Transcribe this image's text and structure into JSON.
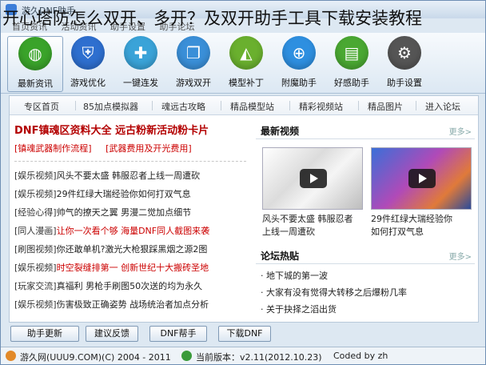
{
  "headline": "开心塔防怎么双开、多开？及双开助手工具下载安装教程",
  "window": {
    "title": "游久DNF助手"
  },
  "menu": [
    "首页资讯",
    "活动资讯",
    "助手设置",
    "助手论坛"
  ],
  "toolbar": [
    {
      "label": "最新资讯",
      "icon": "globe-icon",
      "color": "#3aa32a"
    },
    {
      "label": "游戏优化",
      "icon": "shield-icon",
      "color": "#2e6fcf"
    },
    {
      "label": "一键连发",
      "icon": "gamepad-icon",
      "color": "#3aa3d8"
    },
    {
      "label": "游戏双开",
      "icon": "windows-icon",
      "color": "#3a8fd8"
    },
    {
      "label": "模型补丁",
      "icon": "triangle-icon",
      "color": "#6ab02e"
    },
    {
      "label": "附魔助手",
      "icon": "globe-net-icon",
      "color": "#2e8fe0"
    },
    {
      "label": "好感助手",
      "icon": "document-icon",
      "color": "#4aa832"
    },
    {
      "label": "助手设置",
      "icon": "gear-icon",
      "color": "#555555"
    }
  ],
  "tabs": [
    "专区首页",
    "85加点模拟器",
    "魂远古攻略",
    "精品模型站",
    "精彩视频站",
    "精品图片",
    "进入论坛"
  ],
  "feature": {
    "title": "DNF镇魂区资料大全  远古粉新活动粉卡片",
    "sub1": "[镇魂武器制作流程]",
    "sub2": "[武器费用及开光费用]"
  },
  "news": [
    {
      "tag": "[娱乐视频]",
      "text": "风头不要太盛  韩服忍者上线一周遭砍",
      "red": false
    },
    {
      "tag": "[娱乐视频]",
      "text": "29件红绿大瑞经验你如何打双气息",
      "red": false
    },
    {
      "tag": "[经验心得]",
      "text": "帅气的撩天之翼  男漫二觉加点细节",
      "red": false
    },
    {
      "tag": "[同人漫画]",
      "text": "让你一次看个够  海量DNF同人截图来袭",
      "red": true
    },
    {
      "tag": "[刷图视频]",
      "text": "你还敢单机?激光大枪狠踩黑烟之源2图",
      "red": false
    },
    {
      "tag": "[娱乐视频]",
      "text": "时空裂缝排第一  创新世纪十大搬砖圣地",
      "red": true
    },
    {
      "tag": "[玩家交流]",
      "text": "真福利  男枪手刷图50次送的均为永久",
      "red": false
    },
    {
      "tag": "[娱乐视频]",
      "text": "伤害极致正确姿势  战场统治者加点分析",
      "red": false
    }
  ],
  "video_section": {
    "title": "最新视频",
    "more": "更多>",
    "items": [
      {
        "caption1": "风头不要太盛  韩服忍者",
        "caption2": "上线一周遭砍"
      },
      {
        "caption1": "29件红绿大瑞经验你",
        "caption2": "如何打双气息"
      }
    ]
  },
  "forum_section": {
    "title": "论坛热贴",
    "more": "更多>",
    "items": [
      "· 地下城的第一波",
      "· 大家有没有觉得大转移之后爆粉几率",
      "· 关于抉择之滔出货"
    ]
  },
  "bottom_buttons": [
    "助手更新",
    "建议反馈",
    "DNF帮手",
    "下载DNF"
  ],
  "status": {
    "site": "游久网(UUU9.COM)(C) 2004 - 2011",
    "version": "当前版本：v2.11(2012.10.23)",
    "coded": "Coded by zh"
  }
}
